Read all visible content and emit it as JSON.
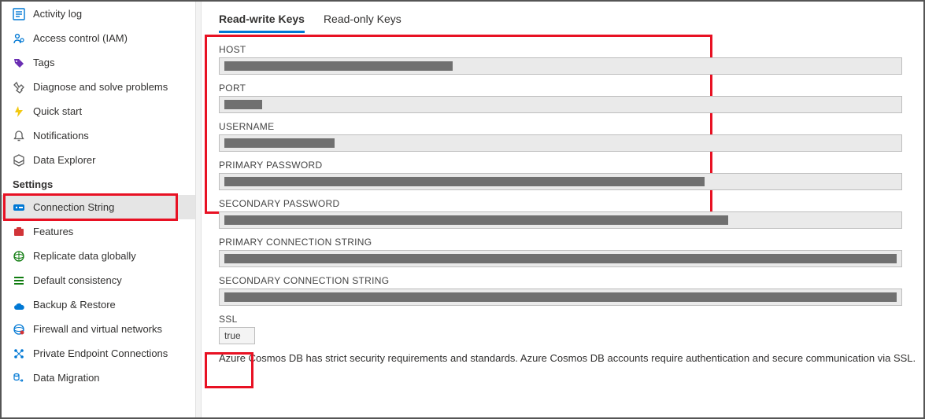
{
  "sidebar": {
    "top_items": [
      {
        "label": "Activity log",
        "icon": "activity-log-icon",
        "color": "#0078d4"
      },
      {
        "label": "Access control (IAM)",
        "icon": "access-control-icon",
        "color": "#0078d4"
      },
      {
        "label": "Tags",
        "icon": "tags-icon",
        "color": "#6b2fb3"
      },
      {
        "label": "Diagnose and solve problems",
        "icon": "diagnose-icon",
        "color": "#5c5c5c"
      },
      {
        "label": "Quick start",
        "icon": "quick-start-icon",
        "color": "#f2c811"
      },
      {
        "label": "Notifications",
        "icon": "notifications-icon",
        "color": "#5c5c5c"
      },
      {
        "label": "Data Explorer",
        "icon": "data-explorer-icon",
        "color": "#5c5c5c"
      }
    ],
    "settings_header": "Settings",
    "settings_items": [
      {
        "label": "Connection String",
        "icon": "connection-string-icon",
        "color": "#0078d4",
        "selected": true,
        "highlight": true
      },
      {
        "label": "Features",
        "icon": "features-icon",
        "color": "#d13438"
      },
      {
        "label": "Replicate data globally",
        "icon": "replicate-icon",
        "color": "#107c10"
      },
      {
        "label": "Default consistency",
        "icon": "consistency-icon",
        "color": "#107c10"
      },
      {
        "label": "Backup & Restore",
        "icon": "backup-icon",
        "color": "#0078d4"
      },
      {
        "label": "Firewall and virtual networks",
        "icon": "firewall-icon",
        "color": "#0078d4"
      },
      {
        "label": "Private Endpoint Connections",
        "icon": "endpoint-icon",
        "color": "#0078d4"
      },
      {
        "label": "Data Migration",
        "icon": "migration-icon",
        "color": "#0078d4"
      }
    ]
  },
  "tabs": [
    {
      "label": "Read-write Keys",
      "active": true
    },
    {
      "label": "Read-only Keys",
      "active": false
    }
  ],
  "fields": [
    {
      "label": "HOST",
      "redact_width": 290
    },
    {
      "label": "PORT",
      "redact_width": 48
    },
    {
      "label": "USERNAME",
      "redact_width": 140
    },
    {
      "label": "PRIMARY PASSWORD",
      "redact_width": 610
    },
    {
      "label": "SECONDARY PASSWORD",
      "redact_width": 640
    },
    {
      "label": "PRIMARY CONNECTION STRING",
      "redact_width": 860
    },
    {
      "label": "SECONDARY CONNECTION STRING",
      "redact_width": 860
    }
  ],
  "ssl": {
    "label": "SSL",
    "value": "true"
  },
  "footer": "Azure Cosmos DB has strict security requirements and standards. Azure Cosmos DB accounts require authentication and secure communication via SSL."
}
